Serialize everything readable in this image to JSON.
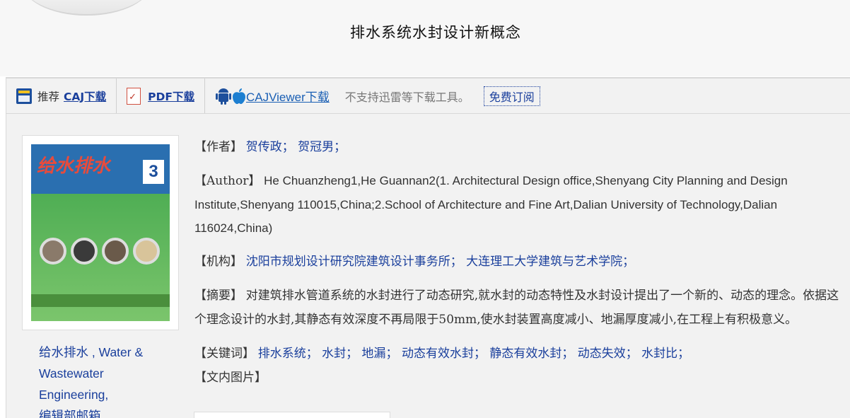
{
  "page": {
    "title": "排水系统水封设计新概念"
  },
  "toolbar": {
    "recommend_label": "推荐",
    "caj_label": "CAJ下载",
    "pdf_label": "PDF下载",
    "viewer_label": "CAJViewer下载",
    "note": "不支持迅雷等下载工具。",
    "subscribe_label": "免费订阅"
  },
  "sidebar": {
    "journal_line1": "给水排水 , Water &",
    "journal_line2": "Wastewater",
    "journal_line3": "Engineering,",
    "journal_line4": "编辑部邮箱"
  },
  "cover": {
    "title_text": "给水排水",
    "issue_number": "3"
  },
  "article": {
    "author_label": "【作者】",
    "author_value": "贺传政；  贺冠男；",
    "author_en_label": "【Author】",
    "author_en_value": "He Chuanzheng1,He Guannan2(1. Architectural Design office,Shenyang City Planning and Design Institute,Shenyang 110015,China;2.School of Architecture and Fine Art,Dalian University of Technology,Dalian 116024,China)",
    "org_label": "【机构】",
    "org_value": "沈阳市规划设计研究院建筑设计事务所；  大连理工大学建筑与艺术学院；",
    "abstract_label": "【摘要】",
    "abstract_value": "对建筑排水管道系统的水封进行了动态研究,就水封的动态特性及水封设计提出了一个新的、动态的理念。依据这个理念设计的水封,其静态有效深度不再局限于50mm,使水封装置高度减小、地漏厚度减小,在工程上有积极意义。",
    "keywords_label": "【关键词】",
    "keywords_value": "排水系统；  水封；  地漏；  动态有效水封；  静态有效水封；  动态失效；  水封比；",
    "figures_label": "【文内图片】"
  },
  "colors": {
    "link": "#1a3f9c",
    "toolbar_bg": "#f2f2f2",
    "header_bg": "#f7f7f7"
  },
  "icons": [
    "caj-icon",
    "pdf-icon",
    "android-icon",
    "apple-icon"
  ]
}
